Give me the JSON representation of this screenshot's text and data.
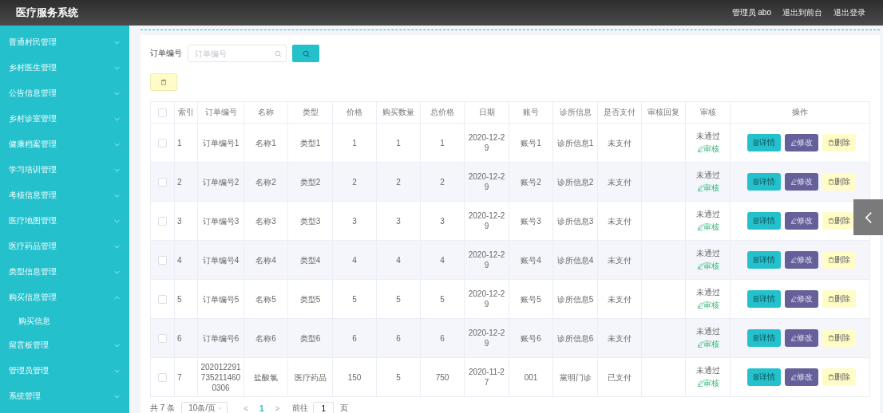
{
  "header": {
    "title": "医疗服务系统",
    "links": [
      {
        "kind": "user",
        "label": "管理员 abo"
      },
      {
        "kind": "link",
        "label": "退出到前台"
      },
      {
        "kind": "link",
        "label": "退出登录"
      }
    ]
  },
  "sidebar": {
    "items": [
      {
        "label": "普通村民管理",
        "expanded": false
      },
      {
        "label": "乡村医生管理",
        "expanded": false
      },
      {
        "label": "公告信息管理",
        "expanded": false
      },
      {
        "label": "乡村诊室管理",
        "expanded": false
      },
      {
        "label": "健康档案管理",
        "expanded": false
      },
      {
        "label": "学习培训管理",
        "expanded": false
      },
      {
        "label": "考核信息管理",
        "expanded": false
      },
      {
        "label": "医疗地图管理",
        "expanded": false
      },
      {
        "label": "医疗药品管理",
        "expanded": false
      },
      {
        "label": "类型信息管理",
        "expanded": false
      },
      {
        "label": "购买信息管理",
        "expanded": true,
        "children": [
          {
            "label": "购买信息"
          }
        ]
      },
      {
        "label": "留言板管理",
        "expanded": false
      },
      {
        "label": "管理员管理",
        "expanded": false
      },
      {
        "label": "系统管理",
        "expanded": false
      }
    ]
  },
  "search": {
    "label": "订单编号",
    "placeholder": "订单编号"
  },
  "table": {
    "select_all_checked": false,
    "columns": [
      {
        "label": "索引",
        "kind": "text"
      },
      {
        "label": "订单编号",
        "kind": "text"
      },
      {
        "label": "名称",
        "kind": "text"
      },
      {
        "label": "类型",
        "kind": "text"
      },
      {
        "label": "价格",
        "kind": "text"
      },
      {
        "label": "购买数量",
        "kind": "text"
      },
      {
        "label": "总价格",
        "kind": "text"
      },
      {
        "label": "日期",
        "kind": "text"
      },
      {
        "label": "账号",
        "kind": "text"
      },
      {
        "label": "诊所信息",
        "kind": "text"
      },
      {
        "label": "是否支付",
        "kind": "text"
      },
      {
        "label": "审核回复",
        "kind": "blank"
      },
      {
        "label": "审核",
        "kind": "audit"
      },
      {
        "label": "操作",
        "kind": "actions"
      }
    ],
    "rows": [
      {
        "checked": false,
        "cells": [
          "1",
          "订单编号1",
          "名称1",
          "类型1",
          "1",
          "1",
          "1",
          "2020-12-29",
          "账号1",
          "诊所信息1",
          "未支付"
        ],
        "audit_status": "未通过",
        "audit_link": "审核",
        "actions": [
          {
            "kind": "detail",
            "label": "详情"
          },
          {
            "kind": "edit",
            "label": "修改"
          },
          {
            "kind": "delete",
            "label": "删除"
          }
        ]
      },
      {
        "checked": false,
        "cells": [
          "2",
          "订单编号2",
          "名称2",
          "类型2",
          "2",
          "2",
          "2",
          "2020-12-29",
          "账号2",
          "诊所信息2",
          "未支付"
        ],
        "audit_status": "未通过",
        "audit_link": "审核",
        "actions": [
          {
            "kind": "detail",
            "label": "详情"
          },
          {
            "kind": "edit",
            "label": "修改"
          },
          {
            "kind": "delete",
            "label": "删除"
          }
        ]
      },
      {
        "checked": false,
        "cells": [
          "3",
          "订单编号3",
          "名称3",
          "类型3",
          "3",
          "3",
          "3",
          "2020-12-29",
          "账号3",
          "诊所信息3",
          "未支付"
        ],
        "audit_status": "未通过",
        "audit_link": "审核",
        "actions": [
          {
            "kind": "detail",
            "label": "详情"
          },
          {
            "kind": "edit",
            "label": "修改"
          },
          {
            "kind": "delete",
            "label": "删除"
          }
        ]
      },
      {
        "checked": false,
        "cells": [
          "4",
          "订单编号4",
          "名称4",
          "类型4",
          "4",
          "4",
          "4",
          "2020-12-29",
          "账号4",
          "诊所信息4",
          "未支付"
        ],
        "audit_status": "未通过",
        "audit_link": "审核",
        "actions": [
          {
            "kind": "detail",
            "label": "详情"
          },
          {
            "kind": "edit",
            "label": "修改"
          },
          {
            "kind": "delete",
            "label": "删除"
          }
        ]
      },
      {
        "checked": false,
        "cells": [
          "5",
          "订单编号5",
          "名称5",
          "类型5",
          "5",
          "5",
          "5",
          "2020-12-29",
          "账号5",
          "诊所信息5",
          "未支付"
        ],
        "audit_status": "未通过",
        "audit_link": "审核",
        "actions": [
          {
            "kind": "detail",
            "label": "详情"
          },
          {
            "kind": "edit",
            "label": "修改"
          },
          {
            "kind": "delete",
            "label": "删除"
          }
        ]
      },
      {
        "checked": false,
        "cells": [
          "6",
          "订单编号6",
          "名称6",
          "类型6",
          "6",
          "6",
          "6",
          "2020-12-29",
          "账号6",
          "诊所信息6",
          "未支付"
        ],
        "audit_status": "未通过",
        "audit_link": "审核",
        "actions": [
          {
            "kind": "detail",
            "label": "详情"
          },
          {
            "kind": "edit",
            "label": "修改"
          },
          {
            "kind": "delete",
            "label": "删除"
          }
        ]
      },
      {
        "checked": false,
        "cells": [
          "7",
          "2020122917352114600306",
          "盐酸氯",
          "医疗药品",
          "150",
          "5",
          "750",
          "2020-11-27",
          "001",
          "黨明门诊",
          "已支付"
        ],
        "audit_status": "未通过",
        "audit_link": "审核",
        "actions": [
          {
            "kind": "detail",
            "label": "详情"
          },
          {
            "kind": "edit",
            "label": "修改"
          },
          {
            "kind": "delete",
            "label": "删除"
          }
        ]
      }
    ]
  },
  "pagination": {
    "total": "共 7 条",
    "page_size": "10条/页",
    "prev": "<",
    "pages": [
      {
        "label": "1",
        "selected": true
      }
    ],
    "next": ">",
    "goto_label": "前往",
    "goto_value": "1",
    "goto_suffix": "页"
  }
}
